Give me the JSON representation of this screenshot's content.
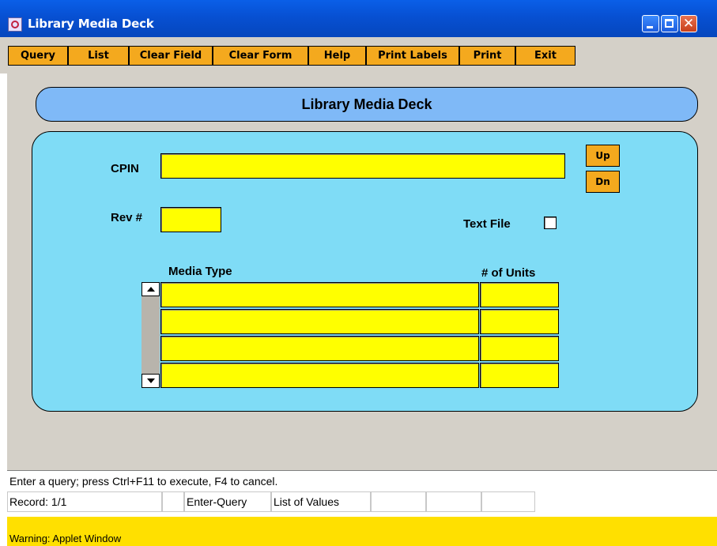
{
  "window": {
    "title": "Library Media Deck"
  },
  "toolbar": {
    "buttons": [
      "Query",
      "List",
      "Clear Field",
      "Clear Form",
      "Help",
      "Print Labels",
      "Print",
      "Exit"
    ]
  },
  "form": {
    "header": "Library Media Deck",
    "cpin_label": "CPIN",
    "cpin_value": "",
    "rev_label": "Rev #",
    "rev_value": "",
    "up_label": "Up",
    "down_label": "Dn",
    "text_file_label": "Text File",
    "text_file_checked": false,
    "media_type_header": "Media Type",
    "units_header": "# of Units",
    "rows": [
      {
        "media_type": "",
        "units": ""
      },
      {
        "media_type": "",
        "units": ""
      },
      {
        "media_type": "",
        "units": ""
      },
      {
        "media_type": "",
        "units": ""
      }
    ]
  },
  "status": {
    "message": "Enter a query;  press Ctrl+F11 to execute, F4 to cancel.",
    "record": "Record: 1/1",
    "mode": "Enter-Query",
    "lov": "List of Values"
  },
  "warning": "Warning: Applet Window",
  "colors": {
    "button_orange": "#f4a91e",
    "field_yellow": "#ffff00",
    "panel_cyan": "#7fdcf6",
    "header_blue": "#7fb9f7"
  }
}
